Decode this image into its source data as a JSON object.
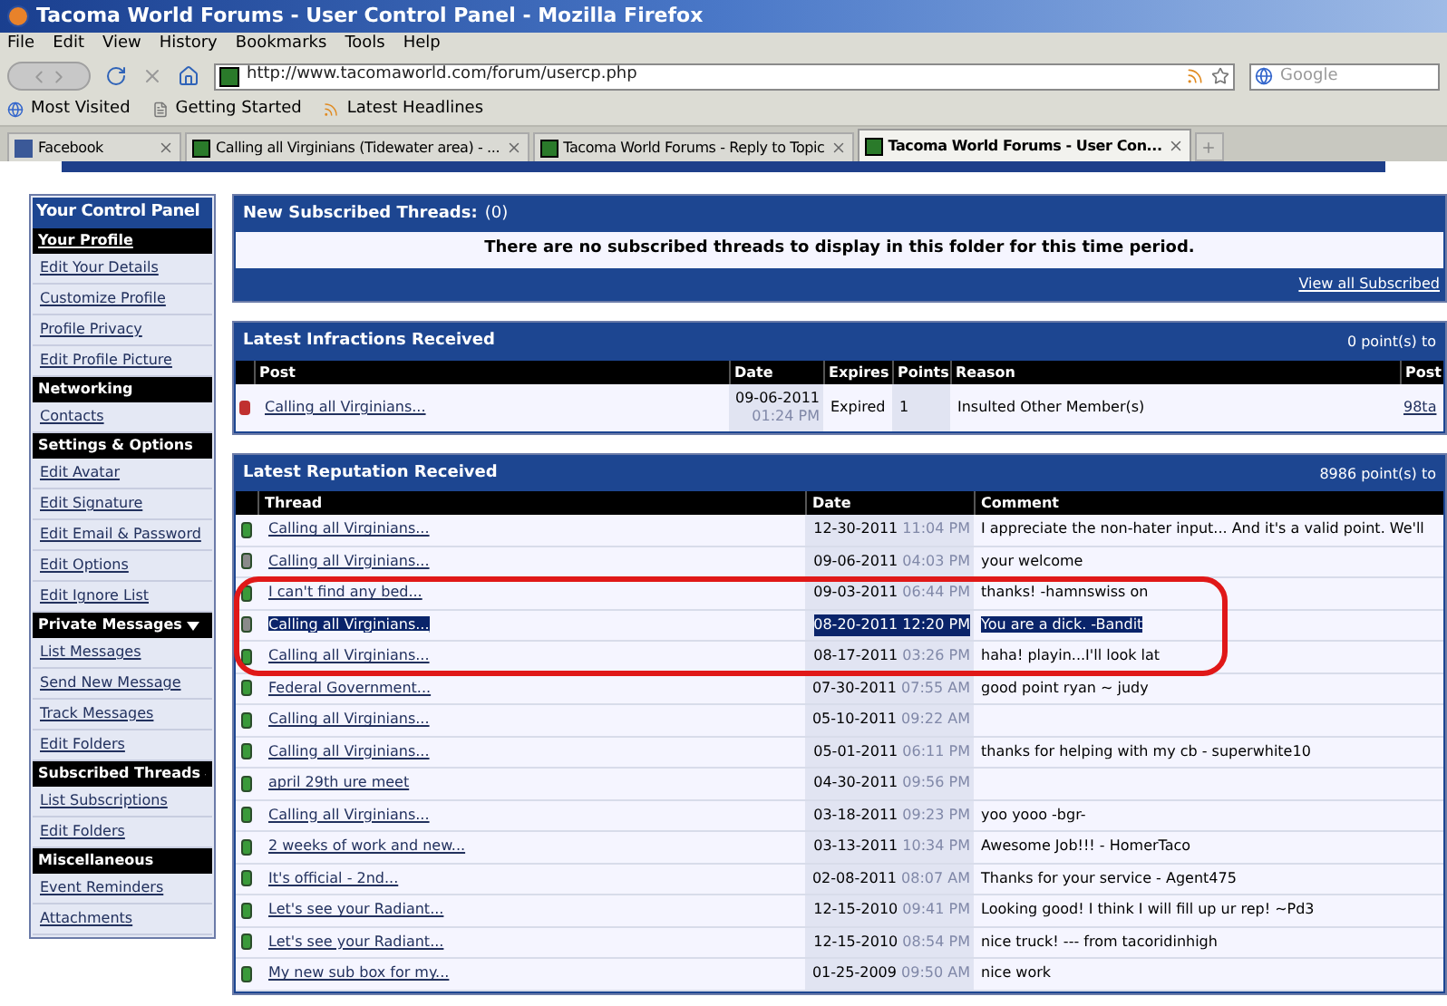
{
  "window": {
    "title": "Tacoma World Forums - User Control Panel - Mozilla Firefox"
  },
  "menu": [
    "File",
    "Edit",
    "View",
    "History",
    "Bookmarks",
    "Tools",
    "Help"
  ],
  "address_bar": {
    "value": "http://www.tacomaworld.com/forum/usercp.php"
  },
  "search": {
    "placeholder": "Google"
  },
  "bookmarks": [
    "Most Visited",
    "Getting Started",
    "Latest Headlines"
  ],
  "tabs": [
    {
      "label": "Facebook",
      "kind": "facebook",
      "selected": false
    },
    {
      "label": "Calling all Virginians (Tidewater area) - ...",
      "kind": "site",
      "selected": false
    },
    {
      "label": "Tacoma World Forums - Reply to Topic",
      "kind": "site",
      "selected": false
    },
    {
      "label": "Tacoma World Forums - User Con...",
      "kind": "site",
      "selected": true
    }
  ],
  "sidebar": {
    "title": "Your Control Panel",
    "items": [
      {
        "label": "Your Profile",
        "kind": "header"
      },
      {
        "label": "Edit Your Details",
        "kind": "link"
      },
      {
        "label": "Customize Profile",
        "kind": "link"
      },
      {
        "label": "Profile Privacy",
        "kind": "link"
      },
      {
        "label": "Edit Profile Picture",
        "kind": "link"
      },
      {
        "label": "Networking",
        "kind": "header"
      },
      {
        "label": "Contacts",
        "kind": "link"
      },
      {
        "label": "Settings & Options",
        "kind": "header"
      },
      {
        "label": "Edit Avatar",
        "kind": "link"
      },
      {
        "label": "Edit Signature",
        "kind": "link"
      },
      {
        "label": "Edit Email & Password",
        "kind": "link"
      },
      {
        "label": "Edit Options",
        "kind": "link"
      },
      {
        "label": "Edit Ignore List",
        "kind": "link"
      },
      {
        "label": "Private Messages",
        "kind": "menu_header"
      },
      {
        "label": "List Messages",
        "kind": "link"
      },
      {
        "label": "Send New Message",
        "kind": "link"
      },
      {
        "label": "Track Messages",
        "kind": "link"
      },
      {
        "label": "Edit Folders",
        "kind": "link"
      },
      {
        "label": "Subscribed Threads",
        "kind": "menu_header"
      },
      {
        "label": "List Subscriptions",
        "kind": "link"
      },
      {
        "label": "Edit Folders",
        "kind": "link"
      },
      {
        "label": "Miscellaneous",
        "kind": "header"
      },
      {
        "label": "Event Reminders",
        "kind": "link"
      },
      {
        "label": "Attachments",
        "kind": "link"
      }
    ]
  },
  "subscribed": {
    "title": "New Subscribed Threads:",
    "count": "(0)",
    "message": "There are no subscribed threads to display in this folder for this time period.",
    "footer_link": "View all Subscribed"
  },
  "infractions": {
    "title": "Latest Infractions Received",
    "total": "0 point(s) to",
    "columns": [
      "Post",
      "Date",
      "Expires",
      "Points",
      "Reason",
      "Post"
    ],
    "rows": [
      {
        "post": "Calling all Virginians...",
        "date": "09-06-2011",
        "time": "01:24 PM",
        "expires": "Expired",
        "points": "1",
        "reason": "Insulted Other Member(s)",
        "poster": "98ta"
      }
    ]
  },
  "reputation": {
    "title": "Latest Reputation Received",
    "total": "8986 point(s) to",
    "columns": [
      "Thread",
      "Date",
      "Comment"
    ],
    "rows": [
      {
        "kind": "positive",
        "selected": false,
        "thread": "Calling all Virginians...",
        "date": "12-30-2011",
        "time": "11:04 PM",
        "comment": "I appreciate the non-hater input... And it's a valid point. We'll"
      },
      {
        "kind": "neutral",
        "selected": false,
        "thread": "Calling all Virginians...",
        "date": "09-06-2011",
        "time": "04:03 PM",
        "comment": "your welcome"
      },
      {
        "kind": "positive",
        "selected": false,
        "thread": "I can't find any bed...",
        "date": "09-03-2011",
        "time": "06:44 PM",
        "comment": "thanks! -hamnswiss on"
      },
      {
        "kind": "neutral",
        "selected": true,
        "thread": "Calling all Virginians...",
        "date": "08-20-2011",
        "time": "12:20 PM",
        "comment": "You are a dick. -Bandit"
      },
      {
        "kind": "positive",
        "selected": false,
        "thread": "Calling all Virginians...",
        "date": "08-17-2011",
        "time": "03:26 PM",
        "comment": "haha! playin...I'll look lat"
      },
      {
        "kind": "positive",
        "selected": false,
        "thread": "Federal Government...",
        "date": "07-30-2011",
        "time": "07:55 AM",
        "comment": "good point ryan ~ judy"
      },
      {
        "kind": "positive",
        "selected": false,
        "thread": "Calling all Virginians...",
        "date": "05-10-2011",
        "time": "09:22 AM"
      },
      {
        "kind": "positive",
        "selected": false,
        "thread": "Calling all Virginians...",
        "date": "05-01-2011",
        "time": "06:11 PM",
        "comment": "thanks for helping with my cb - superwhite10"
      },
      {
        "kind": "positive",
        "selected": false,
        "thread": "april 29th ure meet",
        "date": "04-30-2011",
        "time": "09:56 PM"
      },
      {
        "kind": "positive",
        "selected": false,
        "thread": "Calling all Virginians...",
        "date": "03-18-2011",
        "time": "09:23 PM",
        "comment": "yoo yooo -bgr-"
      },
      {
        "kind": "positive",
        "selected": false,
        "thread": "2 weeks of work and new...",
        "date": "03-13-2011",
        "time": "10:34 PM",
        "comment": "Awesome Job!!! - HomerTaco"
      },
      {
        "kind": "positive",
        "selected": false,
        "thread": "It's official - 2nd...",
        "date": "02-08-2011",
        "time": "08:07 AM",
        "comment": "Thanks for your service - Agent475"
      },
      {
        "kind": "positive",
        "selected": false,
        "thread": "Let's see your Radiant...",
        "date": "12-15-2010",
        "time": "09:41 PM",
        "comment": "Looking good! I think I will fill up ur rep! ~Pd3"
      },
      {
        "kind": "positive",
        "selected": false,
        "thread": "Let's see your Radiant...",
        "date": "12-15-2010",
        "time": "08:54 PM",
        "comment": "nice truck! --- from tacoridinhigh"
      },
      {
        "kind": "positive",
        "selected": false,
        "thread": "My new sub box for my...",
        "date": "01-25-2009",
        "time": "09:50 AM",
        "comment": "nice work"
      }
    ]
  }
}
